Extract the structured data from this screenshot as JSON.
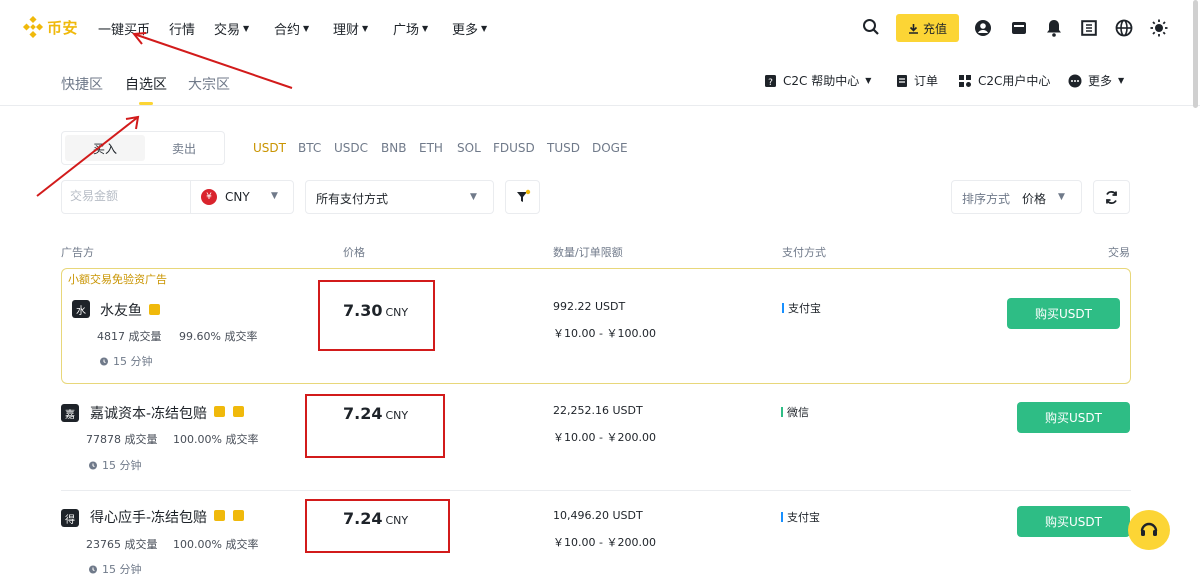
{
  "brand": {
    "name": "币安",
    "color": "#f0b90b"
  },
  "topnav": {
    "items": [
      {
        "label": "一键买币",
        "caret": false
      },
      {
        "label": "行情",
        "caret": false
      },
      {
        "label": "交易",
        "caret": true
      },
      {
        "label": "合约",
        "caret": true
      },
      {
        "label": "理财",
        "caret": true
      },
      {
        "label": "广场",
        "caret": true
      },
      {
        "label": "更多",
        "caret": true
      }
    ],
    "deposit_label": "充值",
    "icons": [
      "search-icon",
      "user-icon",
      "wallet-icon",
      "bell-icon",
      "download-icon",
      "globe-icon",
      "theme-icon"
    ]
  },
  "zones": {
    "tabs": [
      "快捷区",
      "自选区",
      "大宗区"
    ],
    "active": "自选区"
  },
  "subnav_right": {
    "help": "C2C 帮助中心",
    "orders": "订单",
    "user_center": "C2C用户中心",
    "more": "更多"
  },
  "trade": {
    "buy_label": "买入",
    "sell_label": "卖出",
    "coins": [
      "USDT",
      "BTC",
      "USDC",
      "BNB",
      "ETH",
      "SOL",
      "FDUSD",
      "TUSD",
      "DOGE"
    ],
    "active_coin": "USDT"
  },
  "filters": {
    "amount_placeholder": "交易金额",
    "currency": "CNY",
    "payment_method": "所有支付方式",
    "sort_label": "排序方式",
    "sort_value": "价格"
  },
  "table": {
    "headers": [
      "广告方",
      "价格",
      "数量/订单限额",
      "支付方式",
      "交易"
    ],
    "promo_tag": "小额交易免验资广告",
    "rows": [
      {
        "avatar": "水",
        "name": "水友鱼",
        "volume": "4817 成交量",
        "rate": "99.60% 成交率",
        "time": "15 分钟",
        "price": "7.30",
        "unit": "CNY",
        "qty": "992.22 USDT",
        "limit": "￥10.00 - ￥100.00",
        "pay": "支付宝",
        "button": "购买USDT"
      },
      {
        "avatar": "嘉",
        "name": "嘉诚资本-冻结包赔",
        "volume": "77878 成交量",
        "rate": "100.00% 成交率",
        "time": "15 分钟",
        "price": "7.24",
        "unit": "CNY",
        "qty": "22,252.16 USDT",
        "limit": "￥10.00 - ￥200.00",
        "pay": "微信",
        "button": "购买USDT"
      },
      {
        "avatar": "得",
        "name": "得心应手-冻结包赔",
        "volume": "23765 成交量",
        "rate": "100.00% 成交率",
        "time": "15 分钟",
        "price": "7.24",
        "unit": "CNY",
        "qty": "10,496.20 USDT",
        "limit": "￥10.00 - ￥200.00",
        "pay": "支付宝",
        "button": "购买USDT"
      }
    ]
  },
  "colors": {
    "accent": "#fcd535",
    "buy_green": "#2ebd85",
    "highlight_red": "#d21b1b",
    "alipay_blue": "#1890ff"
  }
}
